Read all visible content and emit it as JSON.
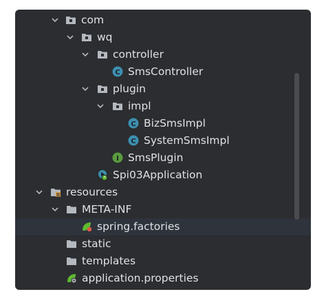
{
  "tree": {
    "items": [
      {
        "label": "com",
        "icon": "package-folder-icon",
        "expanded": true
      },
      {
        "label": "wq",
        "icon": "package-folder-icon",
        "expanded": true
      },
      {
        "label": "controller",
        "icon": "package-folder-icon",
        "expanded": true
      },
      {
        "label": "SmsController",
        "icon": "class-icon"
      },
      {
        "label": "plugin",
        "icon": "package-folder-icon",
        "expanded": true
      },
      {
        "label": "impl",
        "icon": "package-folder-icon",
        "expanded": true
      },
      {
        "label": "BizSmsImpl",
        "icon": "class-icon"
      },
      {
        "label": "SystemSmsImpl",
        "icon": "class-icon"
      },
      {
        "label": "SmsPlugin",
        "icon": "interface-icon"
      },
      {
        "label": "Spi03Application",
        "icon": "spring-boot-app-icon"
      },
      {
        "label": "resources",
        "icon": "resources-folder-icon",
        "expanded": true
      },
      {
        "label": "META-INF",
        "icon": "folder-icon",
        "expanded": true
      },
      {
        "label": "spring.factories",
        "icon": "spring-factories-icon",
        "selected": true
      },
      {
        "label": "static",
        "icon": "folder-icon"
      },
      {
        "label": "templates",
        "icon": "folder-icon"
      },
      {
        "label": "application.properties",
        "icon": "spring-properties-icon"
      }
    ],
    "icon_letters": {
      "class": "C",
      "interface": "I"
    }
  },
  "colors": {
    "panel_bg": "#2b2d30",
    "text": "#dfe1e5",
    "class_icon": "#3d8fb0",
    "interface_icon": "#5a9b3e",
    "folder": "#b4b8bf",
    "spring": "#5fb832",
    "selection": "#2e333c"
  }
}
